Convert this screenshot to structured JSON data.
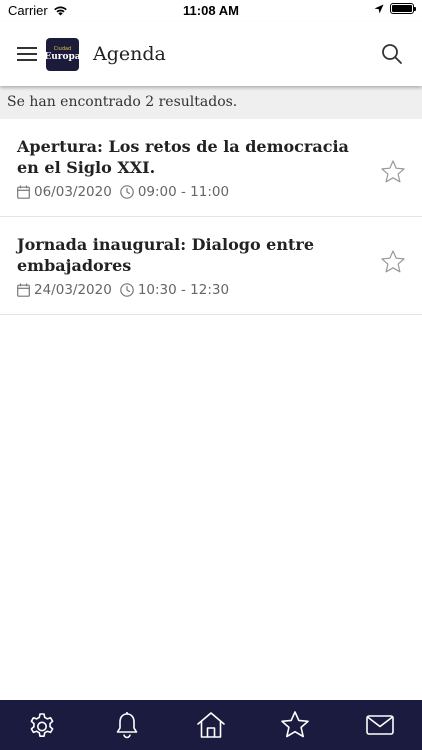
{
  "status_bar": {
    "carrier": "Carrier",
    "time": "11:08 AM"
  },
  "header": {
    "title": "Agenda",
    "logo_small_text": "Ciudad",
    "logo_main_text": "Europa"
  },
  "results": {
    "summary": "Se han encontrado 2 resultados."
  },
  "events": [
    {
      "title": "Apertura: Los retos de la democracia en el Siglo XXI.",
      "date": "06/03/2020",
      "time": "09:00 - 11:00"
    },
    {
      "title": "Jornada inaugural: Dialogo entre embajadores",
      "date": "24/03/2020",
      "time": "10:30 - 12:30"
    }
  ],
  "tab_bar": {
    "items": [
      "gear-icon",
      "bell-icon",
      "home-icon",
      "star-icon",
      "mail-icon"
    ]
  },
  "colors": {
    "tab_bar_bg": "#1b1b3f",
    "results_bar_bg": "#efefef"
  }
}
